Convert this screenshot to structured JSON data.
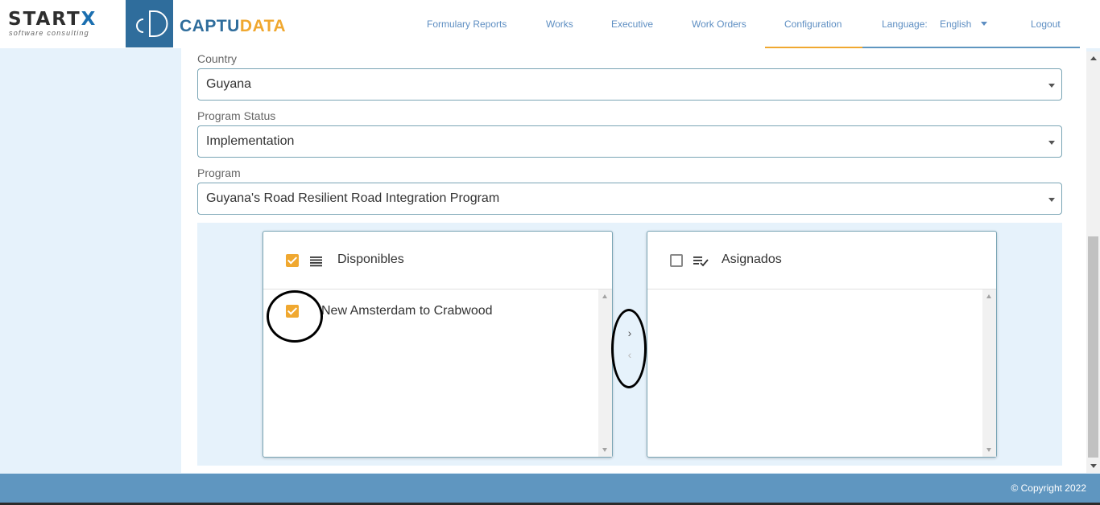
{
  "brand": {
    "startx_prefix": "START",
    "startx_x": "X",
    "startx_tagline": "software consulting",
    "cd_mark": "cD",
    "captudata_a": "CAPTU",
    "captudata_b": "DATA"
  },
  "nav": {
    "formulary_reports": "Formulary Reports",
    "works": "Works",
    "executive": "Executive",
    "work_orders": "Work Orders",
    "configuration": "Configuration",
    "language_label": "Language:",
    "language_value": "English",
    "logout": "Logout"
  },
  "form": {
    "country_label": "Country",
    "country_value": "Guyana",
    "status_label": "Program Status",
    "status_value": "Implementation",
    "program_label": "Program",
    "program_value": "Guyana's Road Resilient Road Integration Program"
  },
  "transfer": {
    "available_title": "Disponibles",
    "assigned_title": "Asignados",
    "available_items": [
      "New Amsterdam to Crabwood"
    ],
    "move_right": "›",
    "move_left": "‹"
  },
  "footer": {
    "copyright": "© Copyright 2022"
  },
  "colors": {
    "accent_orange": "#f0a830",
    "brand_blue": "#2f6d9c",
    "footer_blue": "#5f96c0",
    "nav_text": "#5d8ec2"
  }
}
